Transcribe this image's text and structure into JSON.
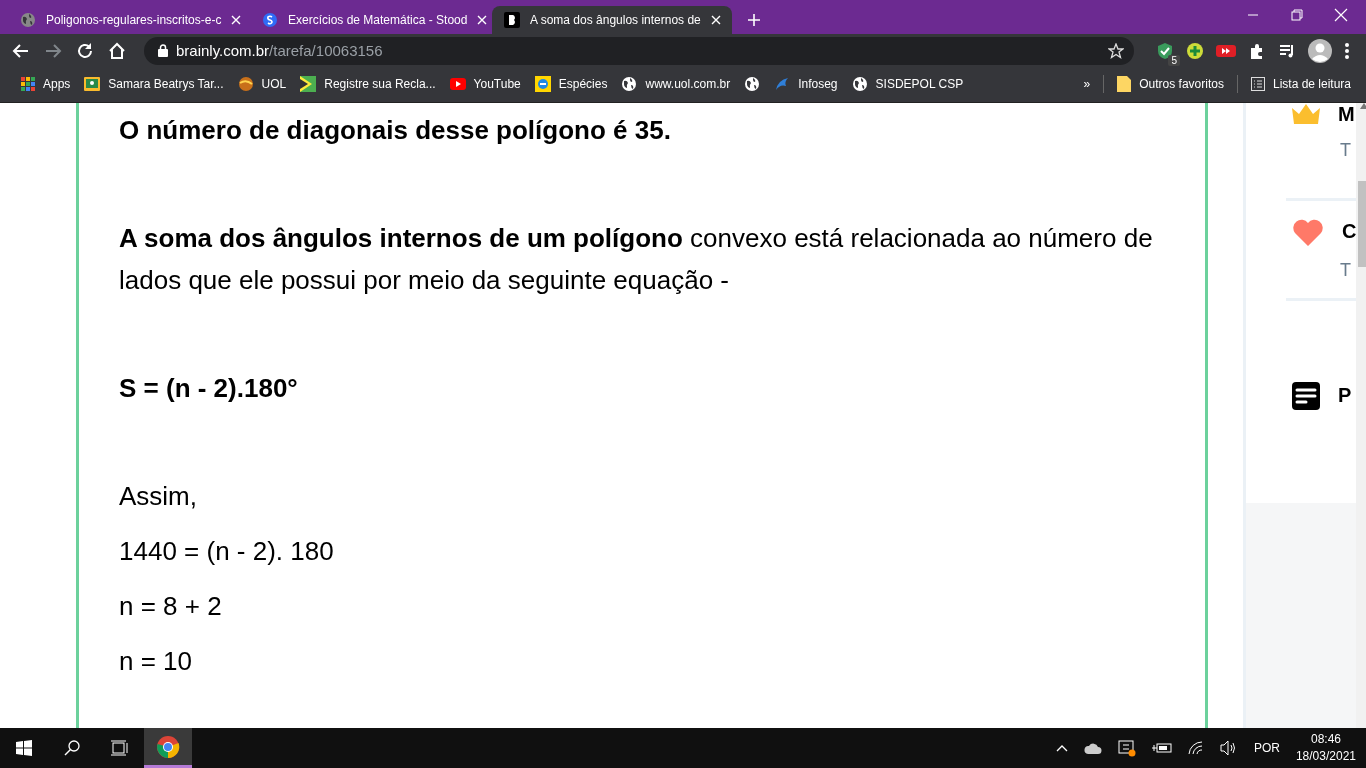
{
  "browser": {
    "tabs": [
      {
        "title": "Poligonos-regulares-inscritos-e-c",
        "selected": false
      },
      {
        "title": "Exercícios de Matemática - Stood",
        "selected": false
      },
      {
        "title": "A soma dos ângulos internos de",
        "selected": true
      }
    ],
    "address": {
      "host": "brainly.com.br",
      "path": "/tarefa/10063156"
    },
    "extension_badge": "5",
    "bookmarks": [
      {
        "kind": "labeled",
        "label": "Apps"
      },
      {
        "kind": "labeled",
        "label": "Samara Beatrys Tar..."
      },
      {
        "kind": "labeled",
        "label": "UOL"
      },
      {
        "kind": "labeled",
        "label": "Registre sua Recla..."
      },
      {
        "kind": "labeled",
        "label": "YouTube"
      },
      {
        "kind": "labeled",
        "label": "Espécies"
      },
      {
        "kind": "labeled",
        "label": "www.uol.com.br"
      },
      {
        "kind": "icon_only"
      },
      {
        "kind": "labeled",
        "label": "Infoseg"
      },
      {
        "kind": "labeled",
        "label": "SISDEPOL CSP"
      }
    ],
    "bookmarks_overflow": "»",
    "other_bookmarks": "Outros favoritos",
    "reading_list": "Lista de leitura"
  },
  "answer": {
    "blocks": [
      {
        "lines": [
          {
            "text": "O número de diagonais desse polígono é 35.",
            "bold": true
          }
        ]
      },
      {
        "lines": [
          {
            "text": "**A soma dos ângulos internos de um polígono** convexo está relacionada ao número de lados que ele possui por meio da seguinte equação -",
            "bold": false
          }
        ]
      },
      {
        "lines": [
          {
            "text": "S = (n - 2).180°",
            "bold": true
          }
        ]
      },
      {
        "lines": [
          {
            "text": "Assim,",
            "bold": false
          },
          {
            "text": "1440 = (n - 2). 180",
            "bold": false
          },
          {
            "text": "n = 8 + 2",
            "bold": false
          },
          {
            "text": "n = 10",
            "bold": false
          }
        ]
      }
    ]
  },
  "sidebar": {
    "items": [
      {
        "heading": "M",
        "subtitle": "T"
      },
      {
        "heading": "C",
        "subtitle": "T"
      },
      {
        "heading": "P"
      }
    ]
  },
  "taskbar": {
    "language": "POR",
    "time": "08:46",
    "date": "18/03/2021"
  }
}
